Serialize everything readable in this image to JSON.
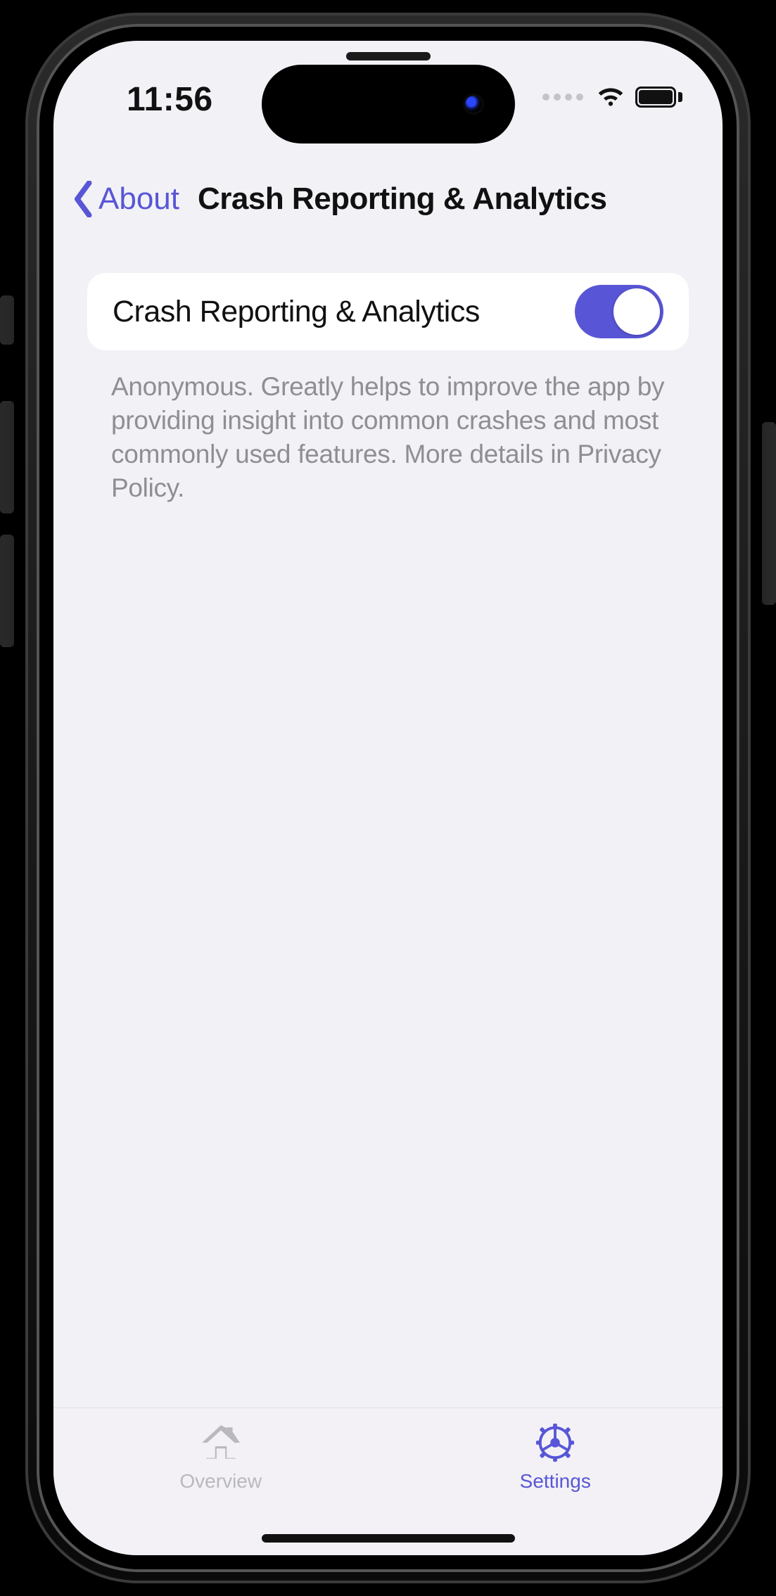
{
  "status": {
    "time": "11:56",
    "battery_pct": 100
  },
  "nav": {
    "back_label": "About",
    "title": "Crash Reporting & Analytics"
  },
  "settings": {
    "crash_analytics": {
      "label": "Crash Reporting & Analytics",
      "enabled": true,
      "footnote": "Anonymous. Greatly helps to improve the app by providing insight into common crashes and most commonly used features. More details in Privacy Policy."
    }
  },
  "tabs": {
    "overview": {
      "label": "Overview",
      "active": false
    },
    "settings": {
      "label": "Settings",
      "active": true
    }
  },
  "colors": {
    "accent": "#5856d6"
  }
}
